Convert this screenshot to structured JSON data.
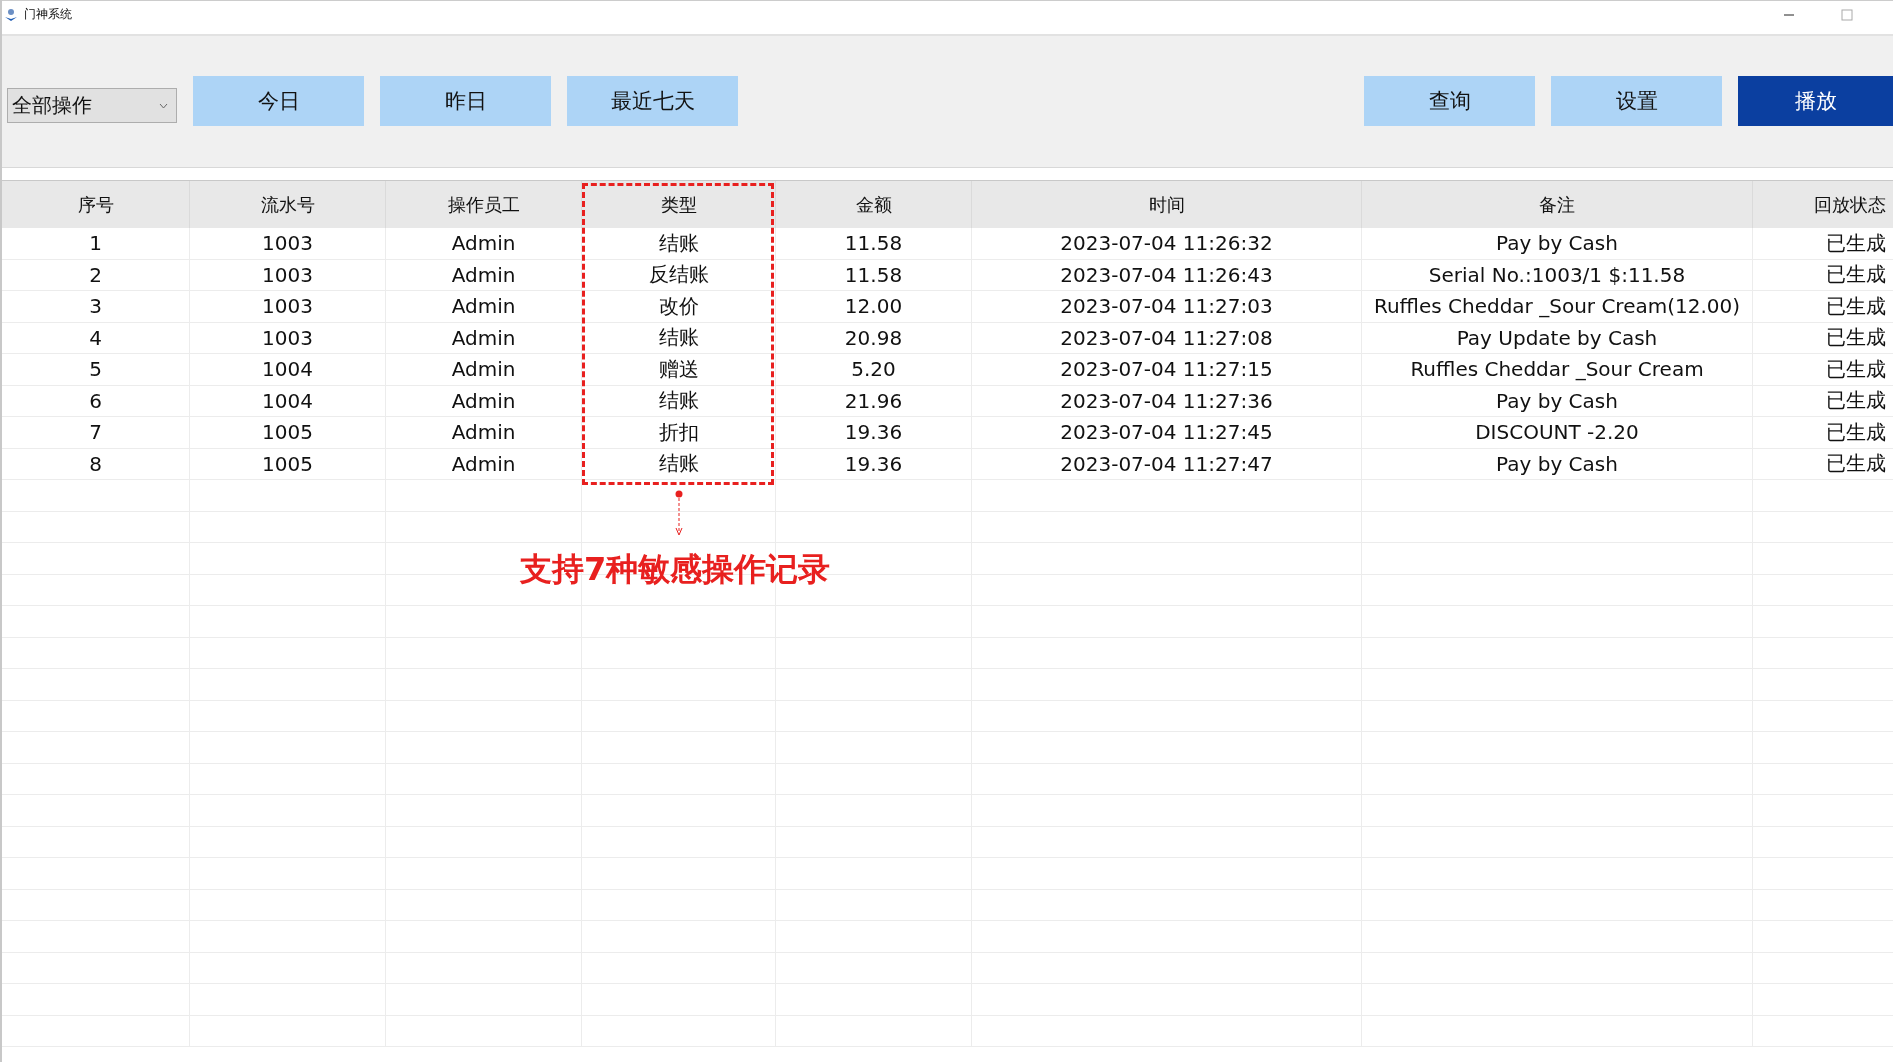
{
  "window": {
    "title": "门神系统"
  },
  "toolbar": {
    "filter": {
      "value": "全部操作"
    },
    "left_buttons": [
      {
        "label": "今日",
        "kind": "default"
      },
      {
        "label": "昨日",
        "kind": "default"
      },
      {
        "label": "最近七天",
        "kind": "default"
      }
    ],
    "right_buttons": [
      {
        "label": "查询",
        "kind": "default"
      },
      {
        "label": "设置",
        "kind": "default"
      },
      {
        "label": "播放",
        "kind": "primary"
      }
    ]
  },
  "table": {
    "columns": [
      "序号",
      "流水号",
      "操作员工",
      "类型",
      "金额",
      "时间",
      "备注",
      "回放状态"
    ],
    "rows": [
      [
        "1",
        "1003",
        "Admin",
        "结账",
        "11.58",
        "2023-07-04 11:26:32",
        "Pay by Cash",
        "已生成"
      ],
      [
        "2",
        "1003",
        "Admin",
        "反结账",
        "11.58",
        "2023-07-04 11:26:43",
        "Serial No.:1003/1  $:11.58",
        "已生成"
      ],
      [
        "3",
        "1003",
        "Admin",
        "改价",
        "12.00",
        "2023-07-04 11:27:03",
        "Ruffles Cheddar _Sour Cream(12.00)",
        "已生成"
      ],
      [
        "4",
        "1003",
        "Admin",
        "结账",
        "20.98",
        "2023-07-04 11:27:08",
        "Pay Update by Cash",
        "已生成"
      ],
      [
        "5",
        "1004",
        "Admin",
        "赠送",
        "5.20",
        "2023-07-04 11:27:15",
        "Ruffles Cheddar _Sour Cream",
        "已生成"
      ],
      [
        "6",
        "1004",
        "Admin",
        "结账",
        "21.96",
        "2023-07-04 11:27:36",
        "Pay by Cash",
        "已生成"
      ],
      [
        "7",
        "1005",
        "Admin",
        "折扣",
        "19.36",
        "2023-07-04 11:27:45",
        "DISCOUNT -2.20",
        "已生成"
      ],
      [
        "8",
        "1005",
        "Admin",
        "结账",
        "19.36",
        "2023-07-04 11:27:47",
        "Pay by Cash",
        "已生成"
      ]
    ]
  },
  "annotation": {
    "text": "支持7种敏感操作记录"
  }
}
